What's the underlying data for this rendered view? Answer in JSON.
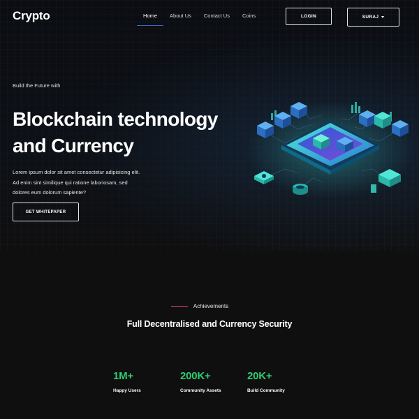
{
  "brand": {
    "name": "Crypto"
  },
  "nav": {
    "items": [
      {
        "label": "Home",
        "active": true
      },
      {
        "label": "About Us",
        "active": false
      },
      {
        "label": "Contact Us",
        "active": false
      },
      {
        "label": "Coins",
        "active": false
      }
    ],
    "login_label": "LOGIN",
    "user_label": "SURAJ"
  },
  "hero": {
    "kicker": "Build the Future with",
    "title_line1": "Blockchain technology",
    "title_line2": "and Currency",
    "description_line1": "Lorem ipsum dolor sit amet consectetur adipisicing elit.",
    "description_line2": "Ad enim sint similique qui ratione laboriosam, sed",
    "description_line3": "dolores eum dolorum sapiente?",
    "cta_label": "GET WHITEPAPER"
  },
  "achievements": {
    "kicker": "Achievements",
    "title": "Full Decentralised and Currency Security",
    "stats": [
      {
        "value": "1M+",
        "label": "Happy Users"
      },
      {
        "value": "200K+",
        "label": "Community Assets"
      },
      {
        "value": "20K+",
        "label": "Build Community"
      }
    ]
  },
  "colors": {
    "background": "#0f0f10",
    "accent_green": "#2ecc71",
    "accent_red": "#d84a5a",
    "nav_active_underline": "#3d66c6",
    "illustration_teal": "#3ad6c6",
    "illustration_blue": "#2a7bd6",
    "illustration_purple": "#7b4bd6"
  },
  "icons": {
    "user_menu": "caret-down-icon",
    "illustration": "blockchain-isometric-illustration"
  }
}
